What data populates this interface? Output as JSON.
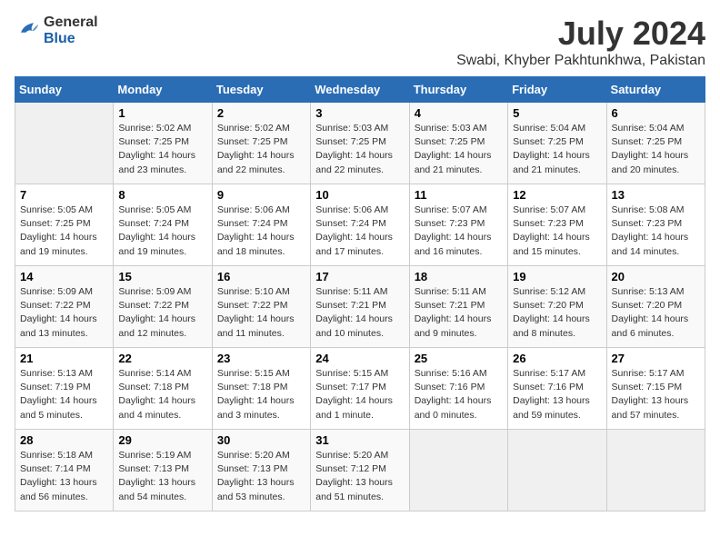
{
  "logo": {
    "general": "General",
    "blue": "Blue"
  },
  "title": "July 2024",
  "subtitle": "Swabi, Khyber Pakhtunkhwa, Pakistan",
  "days_header": [
    "Sunday",
    "Monday",
    "Tuesday",
    "Wednesday",
    "Thursday",
    "Friday",
    "Saturday"
  ],
  "weeks": [
    [
      {
        "day": "",
        "info": ""
      },
      {
        "day": "1",
        "info": "Sunrise: 5:02 AM\nSunset: 7:25 PM\nDaylight: 14 hours\nand 23 minutes."
      },
      {
        "day": "2",
        "info": "Sunrise: 5:02 AM\nSunset: 7:25 PM\nDaylight: 14 hours\nand 22 minutes."
      },
      {
        "day": "3",
        "info": "Sunrise: 5:03 AM\nSunset: 7:25 PM\nDaylight: 14 hours\nand 22 minutes."
      },
      {
        "day": "4",
        "info": "Sunrise: 5:03 AM\nSunset: 7:25 PM\nDaylight: 14 hours\nand 21 minutes."
      },
      {
        "day": "5",
        "info": "Sunrise: 5:04 AM\nSunset: 7:25 PM\nDaylight: 14 hours\nand 21 minutes."
      },
      {
        "day": "6",
        "info": "Sunrise: 5:04 AM\nSunset: 7:25 PM\nDaylight: 14 hours\nand 20 minutes."
      }
    ],
    [
      {
        "day": "7",
        "info": "Sunrise: 5:05 AM\nSunset: 7:25 PM\nDaylight: 14 hours\nand 19 minutes."
      },
      {
        "day": "8",
        "info": "Sunrise: 5:05 AM\nSunset: 7:24 PM\nDaylight: 14 hours\nand 19 minutes."
      },
      {
        "day": "9",
        "info": "Sunrise: 5:06 AM\nSunset: 7:24 PM\nDaylight: 14 hours\nand 18 minutes."
      },
      {
        "day": "10",
        "info": "Sunrise: 5:06 AM\nSunset: 7:24 PM\nDaylight: 14 hours\nand 17 minutes."
      },
      {
        "day": "11",
        "info": "Sunrise: 5:07 AM\nSunset: 7:23 PM\nDaylight: 14 hours\nand 16 minutes."
      },
      {
        "day": "12",
        "info": "Sunrise: 5:07 AM\nSunset: 7:23 PM\nDaylight: 14 hours\nand 15 minutes."
      },
      {
        "day": "13",
        "info": "Sunrise: 5:08 AM\nSunset: 7:23 PM\nDaylight: 14 hours\nand 14 minutes."
      }
    ],
    [
      {
        "day": "14",
        "info": "Sunrise: 5:09 AM\nSunset: 7:22 PM\nDaylight: 14 hours\nand 13 minutes."
      },
      {
        "day": "15",
        "info": "Sunrise: 5:09 AM\nSunset: 7:22 PM\nDaylight: 14 hours\nand 12 minutes."
      },
      {
        "day": "16",
        "info": "Sunrise: 5:10 AM\nSunset: 7:22 PM\nDaylight: 14 hours\nand 11 minutes."
      },
      {
        "day": "17",
        "info": "Sunrise: 5:11 AM\nSunset: 7:21 PM\nDaylight: 14 hours\nand 10 minutes."
      },
      {
        "day": "18",
        "info": "Sunrise: 5:11 AM\nSunset: 7:21 PM\nDaylight: 14 hours\nand 9 minutes."
      },
      {
        "day": "19",
        "info": "Sunrise: 5:12 AM\nSunset: 7:20 PM\nDaylight: 14 hours\nand 8 minutes."
      },
      {
        "day": "20",
        "info": "Sunrise: 5:13 AM\nSunset: 7:20 PM\nDaylight: 14 hours\nand 6 minutes."
      }
    ],
    [
      {
        "day": "21",
        "info": "Sunrise: 5:13 AM\nSunset: 7:19 PM\nDaylight: 14 hours\nand 5 minutes."
      },
      {
        "day": "22",
        "info": "Sunrise: 5:14 AM\nSunset: 7:18 PM\nDaylight: 14 hours\nand 4 minutes."
      },
      {
        "day": "23",
        "info": "Sunrise: 5:15 AM\nSunset: 7:18 PM\nDaylight: 14 hours\nand 3 minutes."
      },
      {
        "day": "24",
        "info": "Sunrise: 5:15 AM\nSunset: 7:17 PM\nDaylight: 14 hours\nand 1 minute."
      },
      {
        "day": "25",
        "info": "Sunrise: 5:16 AM\nSunset: 7:16 PM\nDaylight: 14 hours\nand 0 minutes."
      },
      {
        "day": "26",
        "info": "Sunrise: 5:17 AM\nSunset: 7:16 PM\nDaylight: 13 hours\nand 59 minutes."
      },
      {
        "day": "27",
        "info": "Sunrise: 5:17 AM\nSunset: 7:15 PM\nDaylight: 13 hours\nand 57 minutes."
      }
    ],
    [
      {
        "day": "28",
        "info": "Sunrise: 5:18 AM\nSunset: 7:14 PM\nDaylight: 13 hours\nand 56 minutes."
      },
      {
        "day": "29",
        "info": "Sunrise: 5:19 AM\nSunset: 7:13 PM\nDaylight: 13 hours\nand 54 minutes."
      },
      {
        "day": "30",
        "info": "Sunrise: 5:20 AM\nSunset: 7:13 PM\nDaylight: 13 hours\nand 53 minutes."
      },
      {
        "day": "31",
        "info": "Sunrise: 5:20 AM\nSunset: 7:12 PM\nDaylight: 13 hours\nand 51 minutes."
      },
      {
        "day": "",
        "info": ""
      },
      {
        "day": "",
        "info": ""
      },
      {
        "day": "",
        "info": ""
      }
    ]
  ]
}
